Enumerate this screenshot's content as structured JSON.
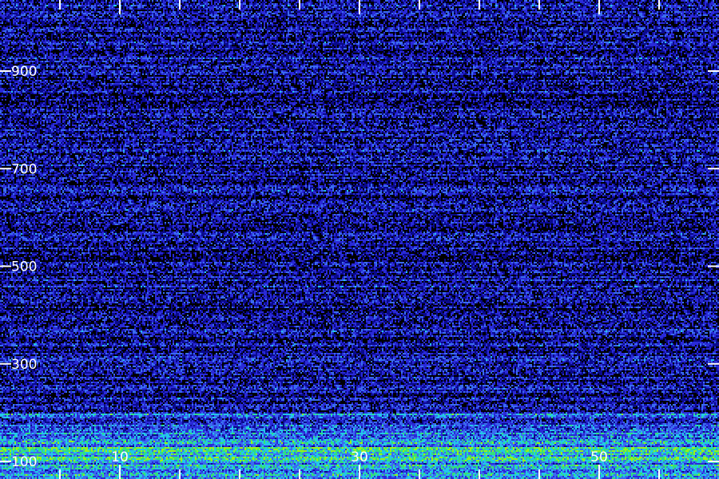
{
  "chart_data": {
    "type": "heatmap",
    "title": "",
    "xlabel": "",
    "ylabel": "",
    "y_range": [
      70,
      1050
    ],
    "y_ticks": [
      100,
      300,
      500,
      700,
      900
    ],
    "y_tick_labels": [
      "100",
      "300",
      "500",
      "700",
      "900"
    ],
    "x_tick_labels": [
      "10",
      "30",
      "50"
    ],
    "x_major_ticks": [
      10,
      30,
      50
    ],
    "x_minor_ticks": [
      5,
      15,
      20,
      25,
      35,
      40,
      45,
      55
    ],
    "x_range": [
      0,
      60
    ],
    "grid": false,
    "legend": "none",
    "colormap": [
      "#000000",
      "#0a0a8c",
      "#2a2ad8",
      "#3a6cf0",
      "#22c8e8",
      "#33e07a",
      "#9af01c"
    ],
    "background_color": "#12128a",
    "description_bands": [
      {
        "y_from": 70,
        "y_to": 100,
        "level": "high"
      },
      {
        "y_from": 100,
        "y_to": 200,
        "level": "elevated"
      },
      {
        "y_from": 200,
        "y_to": 1050,
        "level": "low"
      }
    ]
  }
}
